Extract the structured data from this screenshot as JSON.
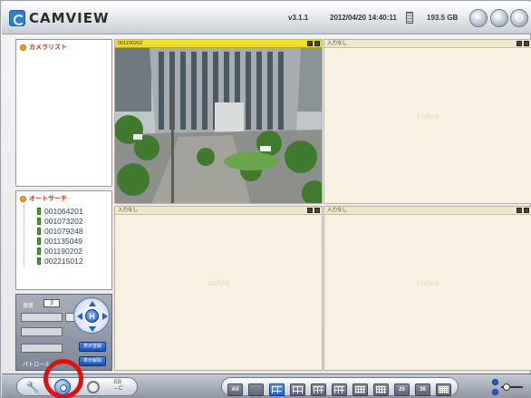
{
  "app": {
    "logo_text": "CAMVIEW",
    "version": "v3.1.1",
    "datetime": "2012/04/20 14:40:11",
    "disk_free": "193.5 GB"
  },
  "camera_list": {
    "title": "カメラリスト"
  },
  "auto_search": {
    "title": "オートサーチ",
    "items": [
      "001064201",
      "001073202",
      "001079248",
      "001135049",
      "001190202",
      "002215012"
    ]
  },
  "control": {
    "speed_label": "速度",
    "speed_value": "3",
    "bottom_label": "パトロール",
    "home_label": "H",
    "btn1_label": "表示登録",
    "btn2_label": "表示解除"
  },
  "cells": [
    {
      "label": "001190202",
      "active": true
    },
    {
      "label": "入力なし",
      "active": false
    },
    {
      "label": "入力なし",
      "active": false
    },
    {
      "label": "入力なし",
      "active": false
    }
  ],
  "watermark": "video",
  "toolbar": {
    "view_label_top": "EB",
    "view_label_bottom": "⇔C",
    "layouts": [
      {
        "label": "All",
        "selected": false
      },
      {
        "label": "",
        "selected": false
      },
      {
        "label": "",
        "selected": true
      },
      {
        "label": "",
        "selected": false
      },
      {
        "label": "",
        "selected": false
      },
      {
        "label": "",
        "selected": false
      },
      {
        "label": "",
        "selected": false
      },
      {
        "label": "",
        "selected": false
      },
      {
        "label": "25",
        "selected": false
      },
      {
        "label": "36",
        "selected": false
      },
      {
        "label": "",
        "selected": false
      }
    ]
  },
  "colors": {
    "accent": "#1c5fd0",
    "active_cell_header": "#f2dc2a",
    "highlight_ring": "#e01010"
  }
}
